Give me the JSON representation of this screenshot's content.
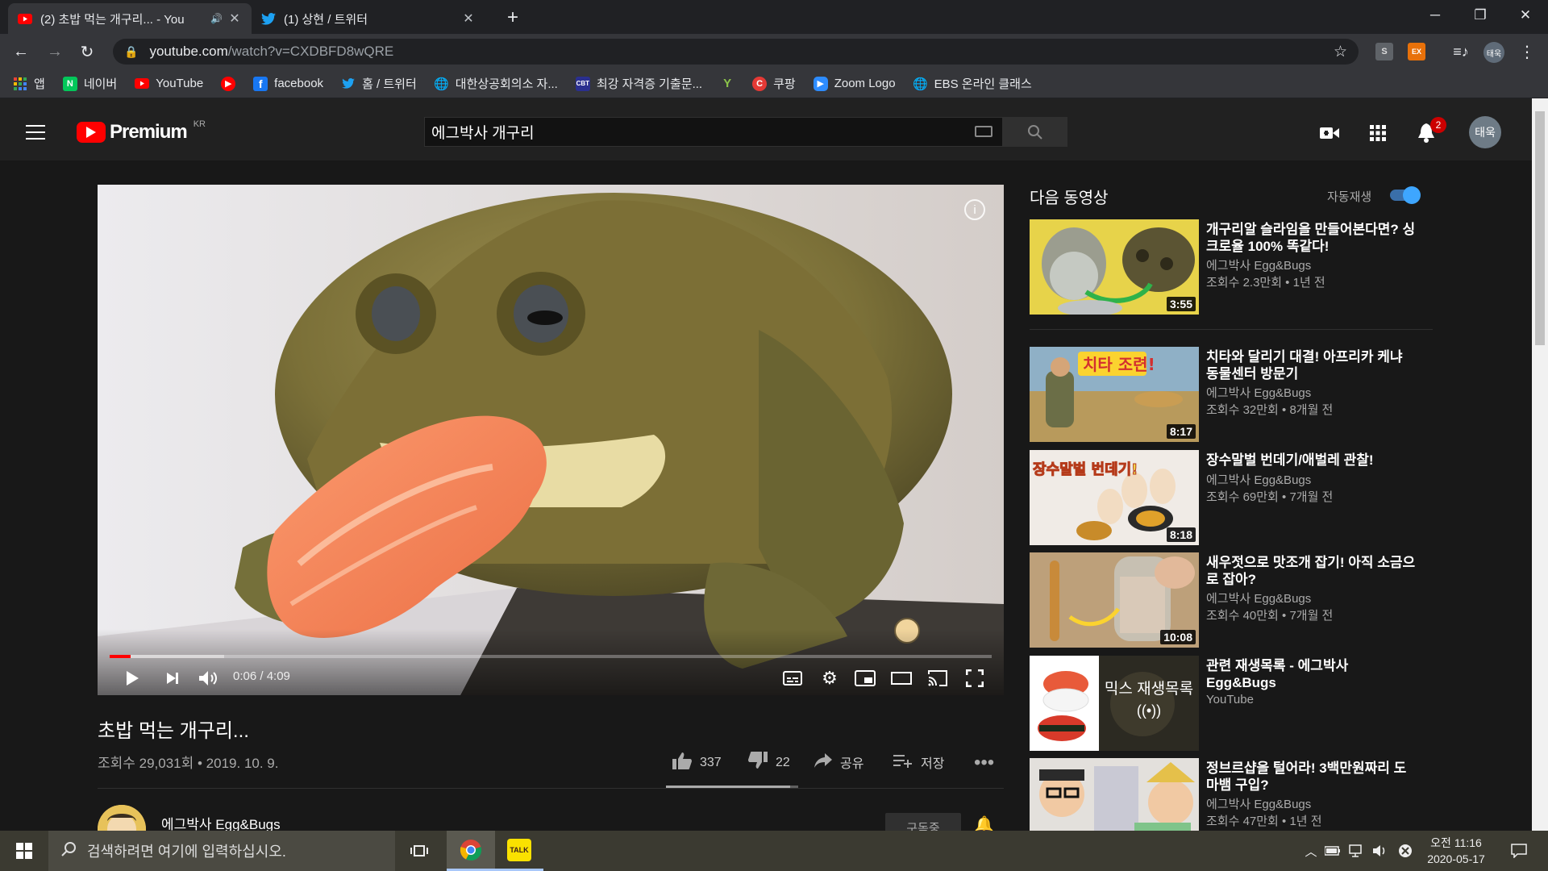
{
  "browser": {
    "tabs": [
      {
        "title": "(2) 초밥 먹는 개구리... - You",
        "active": true
      },
      {
        "title": "(1) 상현 / 트위터",
        "active": false
      }
    ],
    "url_host": "youtube.com",
    "url_path": "/watch?v=CXDBFD8wQRE",
    "extensions": [
      {
        "label": "S",
        "color": "#5f6368"
      },
      {
        "label": "EX",
        "color": "#e8710a"
      }
    ],
    "profile": "태욱",
    "bookmarks": [
      {
        "label": "앱",
        "icon": "apps-grid-icon"
      },
      {
        "label": "네이버",
        "icon": "naver-icon"
      },
      {
        "label": "YouTube",
        "icon": "youtube-icon"
      },
      {
        "label": "",
        "icon": "red-circle-icon"
      },
      {
        "label": "facebook",
        "icon": "facebook-icon"
      },
      {
        "label": "홈 / 트위터",
        "icon": "twitter-icon"
      },
      {
        "label": "대한상공회의소 자...",
        "icon": "globe-icon"
      },
      {
        "label": "최강 자격증 기출문...",
        "icon": "cbt-icon"
      },
      {
        "label": "",
        "icon": "y-icon"
      },
      {
        "label": "쿠팡",
        "icon": "coupang-icon"
      },
      {
        "label": "Zoom Logo",
        "icon": "zoom-icon"
      },
      {
        "label": "EBS 온라인 클래스",
        "icon": "globe-icon"
      }
    ]
  },
  "youtube": {
    "logo_text": "Premium",
    "logo_region": "KR",
    "search_value": "에그박사 개구리",
    "notification_count": "2",
    "avatar_text": "태욱",
    "player": {
      "time": "0:06 / 4:09",
      "progress": 0.024,
      "buffered": 0.13
    },
    "video": {
      "title": "초밥 먹는 개구리...",
      "meta": "조회수 29,031회 • 2019. 10. 9.",
      "likes": "337",
      "dislikes": "22",
      "share": "공유",
      "save": "저장",
      "like_ratio": 0.94
    },
    "channel": {
      "name": "에그박사 Egg&Bugs",
      "subscribe": "구독중"
    },
    "upnext_label": "다음 동영상",
    "autoplay_label": "자동재생",
    "recommendations": [
      {
        "title": "개구리알 슬라임을 만들어본다면? 싱크로율 100% 똑같다!",
        "channel": "에그박사 Egg&Bugs",
        "meta": "조회수 2.3만회 • 1년 전",
        "duration": "3:55",
        "theme": "slime"
      },
      {
        "title": "치타와 달리기 대결! 아프리카 케냐 동물센터 방문기",
        "channel": "에그박사 Egg&Bugs",
        "meta": "조회수 32만회 • 8개월 전",
        "duration": "8:17",
        "theme": "cheetah"
      },
      {
        "title": "장수말벌 번데기/애벌레 관찰!",
        "channel": "에그박사 Egg&Bugs",
        "meta": "조회수 69만회 • 7개월 전",
        "duration": "8:18",
        "theme": "hornet"
      },
      {
        "title": "새우젓으로 맛조개 잡기! 아직 소금으로 잡아?",
        "channel": "에그박사 Egg&Bugs",
        "meta": "조회수 40만회 • 7개월 전",
        "duration": "10:08",
        "theme": "clam"
      },
      {
        "title": "관련 재생목록 - 에그박사 Egg&Bugs",
        "channel": "YouTube",
        "meta": "",
        "duration": "",
        "theme": "mix",
        "overlay": "믹스 재생목록"
      },
      {
        "title": "정브르샵을 털어라! 3백만원짜리 도마뱀 구입?",
        "channel": "에그박사 Egg&Bugs",
        "meta": "조회수 47만회 • 1년 전",
        "duration": "",
        "theme": "shop"
      }
    ]
  },
  "taskbar": {
    "search_placeholder": "검색하려면 여기에 입력하십시오.",
    "time": "오전 11:16",
    "date": "2020-05-17"
  }
}
